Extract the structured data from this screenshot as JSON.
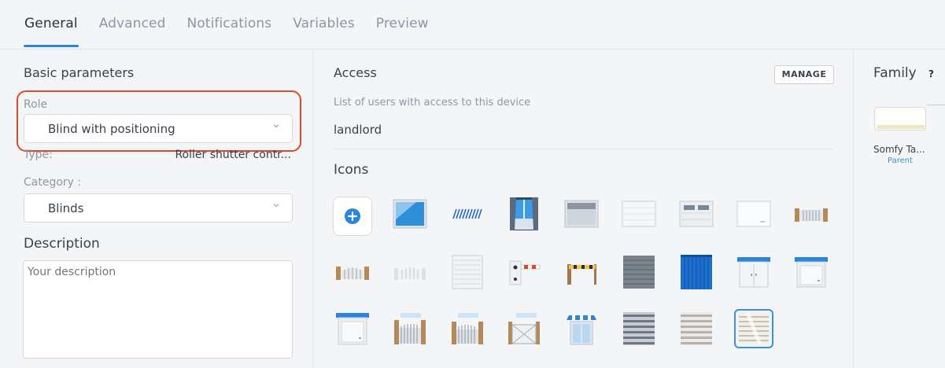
{
  "tabs": [
    {
      "label": "General",
      "active": true
    },
    {
      "label": "Advanced",
      "active": false
    },
    {
      "label": "Notifications",
      "active": false
    },
    {
      "label": "Variables",
      "active": false
    },
    {
      "label": "Preview",
      "active": false
    }
  ],
  "basic": {
    "title": "Basic parameters",
    "role_label": "Role",
    "role_value": "Blind with positioning",
    "type_label": "Type:",
    "type_value": "Roller shutter contr...",
    "category_label": "Category :",
    "category_value": "Blinds",
    "description_title": "Description",
    "description_placeholder": "Your description"
  },
  "access": {
    "title": "Access",
    "manage_label": "MANAGE",
    "subtitle": "List of users with access to this device",
    "users": [
      "landlord"
    ]
  },
  "icons": {
    "title": "Icons",
    "add_glyph": "+",
    "selected_index": 25,
    "items": [
      "add-icon",
      "window-icon",
      "slanted-blind-icon",
      "curtain-window-icon",
      "roller-shutter-icon",
      "garage-door-icon",
      "garage-door-windows-icon",
      "garage-door-plain-icon",
      "gate-icon",
      "fence-gate-icon",
      "swing-gate-icon",
      "shutter-icon",
      "barrier-post-icon",
      "barrier-arm-icon",
      "dark-blind-icon",
      "blue-curtain-icon",
      "blue-double-garage-icon",
      "blue-garage-icon",
      "blue-garage-small-icon",
      "wooden-gate-icon",
      "wooden-gate-2-icon",
      "sliding-gate-icon",
      "awning-door-icon",
      "venetian-blind-icon",
      "light-blind-icon",
      "positioning-blind-icon"
    ]
  },
  "family": {
    "title": "Family",
    "help": "?",
    "device_name": "Somfy Ta...",
    "relation": "Parent"
  },
  "colors": {
    "accent": "#2a86dc",
    "highlight": "#e0472f"
  }
}
